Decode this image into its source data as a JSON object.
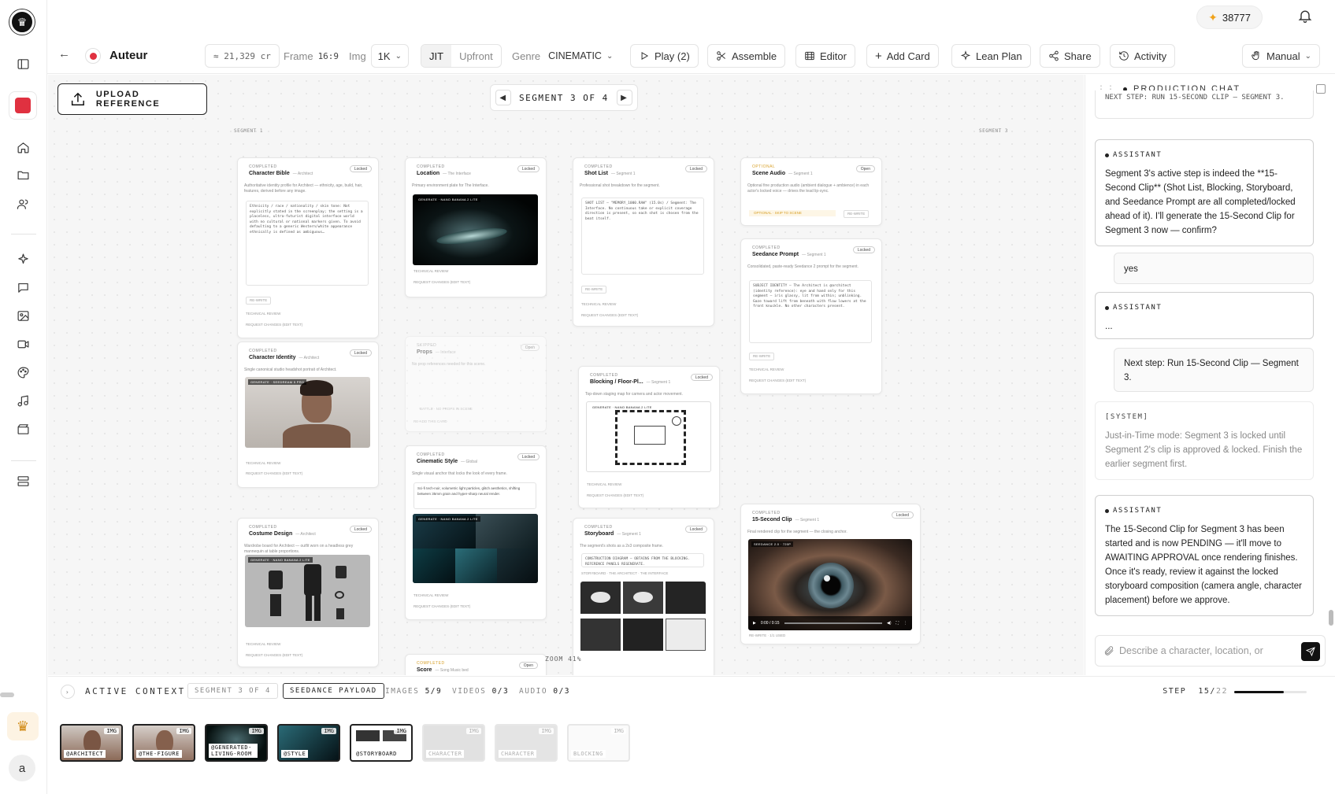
{
  "app": {
    "credits": "38777"
  },
  "toolbar": {
    "title": "Auteur",
    "credit_estimate": "≈ 21,329 cr",
    "frame_label": "Frame",
    "frame_value": "16:9",
    "img_label": "Img",
    "img_value": "1K",
    "mode_jit": "JIT",
    "mode_upfront": "Upfront",
    "genre_label": "Genre",
    "genre_value": "CINEMATIC",
    "play": "Play (2)",
    "assemble": "Assemble",
    "editor": "Editor",
    "add_card": "Add Card",
    "lean_plan": "Lean Plan",
    "share": "Share",
    "activity": "Activity",
    "manual": "Manual"
  },
  "canvas": {
    "upload_label": "UPLOAD REFERENCE",
    "segment_nav": "SEGMENT 3 OF 4",
    "zoom": "ZOOM 41%",
    "columns": [
      "SEGMENT 1",
      "SEGMENT 3"
    ],
    "cards": [
      {
        "status": "COMPLETED",
        "title": "Character Bible",
        "sub": "— Architect",
        "lock": "Locked",
        "desc": "Authoritative identity profile for Architect — ethnicity, age, build, hair, features, derived before any image.",
        "body": "Ethnicity / race / nationality / skin tone: Not explicitly stated in the screenplay; the setting is a placeless, ultra-futurist digital interface world with no cultural or national markers given. To avoid defaulting to a generic Western/white appearance ethnically is defined as ambiguous…",
        "rewrite": "RE-WRITE",
        "meta1": "TECHNICAL REVIEW",
        "meta2": "REQUEST CHANGES (EDIT TEXT)"
      },
      {
        "status": "COMPLETED",
        "title": "Character Identity",
        "sub": "— Architect",
        "lock": "Locked",
        "desc": "Single canonical studio headshot portrait of Architect.",
        "img_tag": "GENERATE · SEEDREAM 5 PRO",
        "meta1": "TECHNICAL REVIEW",
        "meta2": "REQUEST CHANGES (EDIT TEXT)"
      },
      {
        "status": "COMPLETED",
        "title": "Costume Design",
        "sub": "— Architect",
        "lock": "Locked",
        "desc": "Wardrobe board for Architect — outfit worn on a headless grey mannequin at table proportions.",
        "img_tag": "GENERATE · NANO BANANA 2 LITE",
        "meta1": "TECHNICAL REVIEW",
        "meta2": "REQUEST CHANGES (EDIT TEXT)"
      },
      {
        "status": "COMPLETED",
        "title": "Location",
        "sub": "— The Interface",
        "lock": "Locked",
        "desc": "Primary environment plate for The Interface.",
        "img_tag": "GENERATE · NANO BANANA 2 LITE",
        "meta1": "TECHNICAL REVIEW",
        "meta2": "REQUEST CHANGES (EDIT TEXT)"
      },
      {
        "status": "SKIPPED",
        "title": "Props",
        "sub": "— Interface",
        "lock": "Open",
        "desc": "No prop references needed for this scene.",
        "meta1": "BATTLE · NO PROPS IN SCENE",
        "meta2": "RE-ADD THIS CARD"
      },
      {
        "status": "COMPLETED",
        "title": "Cinematic Style",
        "sub": "— Global",
        "lock": "Locked",
        "desc": "Single visual anchor that locks the look of every frame.",
        "body": "Sci-fi tech-noir, volumetric light particles, glitch aesthetics, shifting between 35mm grain and hyper-sharp neural render.",
        "img_tag": "GENERATE · NANO BANANA 2 LITE",
        "meta1": "TECHNICAL REVIEW",
        "meta2": "REQUEST CHANGES (EDIT TEXT)"
      },
      {
        "status": "COMPLETED",
        "title": "Shot List",
        "sub": "— Segment 1",
        "lock": "Locked",
        "desc": "Professional shot breakdown for the segment.",
        "body": "SHOT LIST — \"MEMORY_1000.RAW\" (15.0s) / Segment: The Interface. No continuous take or explicit coverage direction is present, so each shot is chosen from the beat itself.",
        "rewrite": "RE-WRITE",
        "meta1": "TECHNICAL REVIEW",
        "meta2": "REQUEST CHANGES (EDIT TEXT)"
      },
      {
        "status": "COMPLETED",
        "title": "Blocking / Floor-Pl...",
        "sub": "— Segment 1",
        "lock": "Locked",
        "desc": "Top-down staging map for camera and actor movement.",
        "img_tag": "GENERATE · NANO BANANA 2 LITE",
        "meta1": "TECHNICAL REVIEW",
        "meta2": "REQUEST CHANGES (EDIT TEXT)"
      },
      {
        "status": "COMPLETED",
        "title": "Storyboard",
        "sub": "— Segment 1",
        "lock": "Locked",
        "desc": "The segment's shots as a 2x3 composite frame.",
        "body": "CONSTRUCTION DIAGRAM — OBTAINS FROM THE BLOCKING. REFERENCE PANELS REGENERATE.",
        "meta1": "STORYBOARD · THE ARCHITECT · THE INTERFACE"
      },
      {
        "status": "COMPLETED",
        "title": "Score",
        "sub": "— Song Music bed",
        "lock": "Open"
      },
      {
        "status": "OPTIONAL",
        "title": "Scene Audio",
        "sub": "— Segment 1",
        "lock": "Open",
        "desc": "Optional fine production audio (ambient dialogue + ambience) in each actor's locked voice — drives the lead lip-sync.",
        "meta1": "OPTIONAL · SKIP TO SCENE",
        "meta2": "RE-WRITE"
      },
      {
        "status": "COMPLETED",
        "title": "Seedance Prompt",
        "sub": "— Segment 1",
        "lock": "Locked",
        "desc": "Consolidated, paste-ready Seedance 2 prompt for the segment.",
        "body": "SUBJECT IDENTITY — The Architect is @architect (identity reference): eye and hand only for this segment — iris glassy, lit from within; unblinking. Gaze toward lift from beneath with flow lowers at the front knuckle. No other characters present.",
        "rewrite": "RE-WRITE",
        "meta1": "TECHNICAL REVIEW",
        "meta2": "REQUEST CHANGES (EDIT TEXT)"
      },
      {
        "status": "COMPLETED",
        "title": "15-Second Clip",
        "sub": "— Segment 1",
        "lock": "Locked",
        "desc": "Final rendered clip for the segment — the closing anchor.",
        "img_tag": "SEEDANCE 2.0 · 720P",
        "time": "0:00 / 0:15",
        "meta1": "RE-WRITE · 1/1 USED"
      }
    ]
  },
  "chat": {
    "title": "PRODUCTION CHAT",
    "top_fragment": "NEXT STEP: RUN 15-SECOND CLIP — SEGMENT 3.",
    "messages": [
      {
        "role": "ASSISTANT",
        "text": "Segment 3's active step is indeed the **15-Second Clip** (Shot List, Blocking, Storyboard, and Seedance Prompt are all completed/locked ahead of it). I'll generate the 15-Second Clip for Segment 3 now — confirm?"
      },
      {
        "role": "user",
        "text": "yes"
      },
      {
        "role": "ASSISTANT",
        "text": "..."
      },
      {
        "role": "user",
        "text": "Next step: Run 15-Second Clip — Segment 3."
      },
      {
        "role": "[SYSTEM]",
        "text": "Just-in-Time mode: Segment 3 is locked until Segment 2's clip is approved & locked. Finish the earlier segment first."
      },
      {
        "role": "ASSISTANT",
        "text": "The 15-Second Clip for Segment 3 has been started and is now PENDING — it'll move to AWAITING APPROVAL once rendering finishes. Once it's ready, review it against the locked storyboard composition (camera angle, character placement) before we approve."
      }
    ],
    "input_placeholder": "Describe a character, location, or"
  },
  "context": {
    "title": "ACTIVE CONTEXT",
    "segment": "SEGMENT 3 OF 4",
    "payload": "SEEDANCE PAYLOAD",
    "images_label": "IMAGES",
    "images_value": "5/9",
    "videos_label": "VIDEOS",
    "videos_value": "0/3",
    "audio_label": "AUDIO",
    "audio_value": "0/3",
    "step_label": "STEP",
    "step_value": "15/",
    "step_total": "22",
    "step_progress": 0.68
  },
  "thumbnails": [
    {
      "badge": "IMG",
      "caption": "@ARCHITECT",
      "active": true
    },
    {
      "badge": "IMG",
      "caption": "@THE-FIGURE",
      "active": true
    },
    {
      "badge": "IMG",
      "caption": "@GENERATED-LIVING-ROOM",
      "active": true
    },
    {
      "badge": "IMG",
      "caption": "@STYLE",
      "active": true
    },
    {
      "badge": "IMG",
      "caption": "@STORYBOARD",
      "active": true
    },
    {
      "badge": "IMG",
      "caption": "CHARACTER",
      "active": false
    },
    {
      "badge": "IMG",
      "caption": "CHARACTER",
      "active": false
    },
    {
      "badge": "IMG",
      "caption": "BLOCKING",
      "active": false
    }
  ],
  "colors": {
    "accent_red": "#e03140",
    "credit_star": "#f0a21a",
    "ink": "#111111"
  }
}
